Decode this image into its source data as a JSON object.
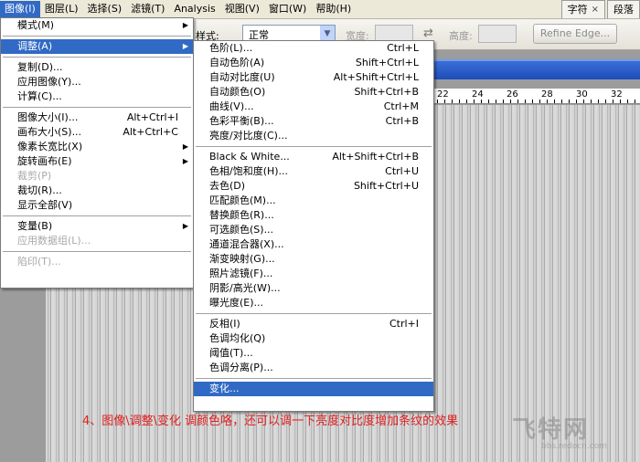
{
  "menubar": {
    "items": [
      {
        "label": "图像(I)",
        "active": true
      },
      {
        "label": "图层(L)"
      },
      {
        "label": "选择(S)"
      },
      {
        "label": "滤镜(T)"
      },
      {
        "label": "Analysis"
      },
      {
        "label": "视图(V)"
      },
      {
        "label": "窗口(W)"
      },
      {
        "label": "帮助(H)"
      }
    ],
    "panel_tabs": [
      {
        "label": "字符",
        "close": "×"
      },
      {
        "label": "段落"
      }
    ]
  },
  "options": {
    "style_label": "样式:",
    "style_value": "正常",
    "width_label": "宽度:",
    "height_label": "高度:",
    "refine_edge": "Refine Edge..."
  },
  "ruler": {
    "marks": [
      "22",
      "24",
      "26",
      "28",
      "30",
      "32"
    ]
  },
  "image_menu": {
    "items": [
      {
        "label": "模式(M)",
        "submenu": true
      },
      {
        "sep": true
      },
      {
        "label": "调整(A)",
        "submenu": true,
        "highlight": true
      },
      {
        "sep": true
      },
      {
        "label": "复制(D)..."
      },
      {
        "label": "应用图像(Y)..."
      },
      {
        "label": "计算(C)..."
      },
      {
        "sep": true
      },
      {
        "label": "图像大小(I)...",
        "shortcut": "Alt+Ctrl+I"
      },
      {
        "label": "画布大小(S)...",
        "shortcut": "Alt+Ctrl+C"
      },
      {
        "label": "像素长宽比(X)",
        "submenu": true
      },
      {
        "label": "旋转画布(E)",
        "submenu": true
      },
      {
        "label": "裁剪(P)",
        "disabled": true
      },
      {
        "label": "裁切(R)..."
      },
      {
        "label": "显示全部(V)"
      },
      {
        "sep": true
      },
      {
        "label": "变量(B)",
        "submenu": true
      },
      {
        "label": "应用数据组(L)...",
        "disabled": true
      },
      {
        "sep": true
      },
      {
        "label": "陷印(T)...",
        "disabled": true
      }
    ]
  },
  "adjust_menu": {
    "items": [
      {
        "label": "色阶(L)...",
        "shortcut": "Ctrl+L"
      },
      {
        "label": "自动色阶(A)",
        "shortcut": "Shift+Ctrl+L"
      },
      {
        "label": "自动对比度(U)",
        "shortcut": "Alt+Shift+Ctrl+L"
      },
      {
        "label": "自动颜色(O)",
        "shortcut": "Shift+Ctrl+B"
      },
      {
        "label": "曲线(V)...",
        "shortcut": "Ctrl+M"
      },
      {
        "label": "色彩平衡(B)...",
        "shortcut": "Ctrl+B"
      },
      {
        "label": "亮度/对比度(C)..."
      },
      {
        "sep": true
      },
      {
        "label": "Black & White...",
        "shortcut": "Alt+Shift+Ctrl+B"
      },
      {
        "label": "色相/饱和度(H)...",
        "shortcut": "Ctrl+U"
      },
      {
        "label": "去色(D)",
        "shortcut": "Shift+Ctrl+U"
      },
      {
        "label": "匹配颜色(M)..."
      },
      {
        "label": "替换颜色(R)..."
      },
      {
        "label": "可选颜色(S)..."
      },
      {
        "label": "通道混合器(X)..."
      },
      {
        "label": "渐变映射(G)..."
      },
      {
        "label": "照片滤镜(F)..."
      },
      {
        "label": "阴影/高光(W)..."
      },
      {
        "label": "曝光度(E)..."
      },
      {
        "sep": true
      },
      {
        "label": "反相(I)",
        "shortcut": "Ctrl+I"
      },
      {
        "label": "色调均化(Q)"
      },
      {
        "label": "阈值(T)..."
      },
      {
        "label": "色调分离(P)..."
      },
      {
        "sep": true
      },
      {
        "label": "变化...",
        "highlight": true
      }
    ]
  },
  "caption": "4、图像\\调整\\变化 调颜色咯，还可以调一下亮度对比度增加条纹的效果",
  "watermark": {
    "text": "飞特网",
    "url": "bbs.redocn.com"
  },
  "colors": {
    "highlight": "#316ac5",
    "caption": "#e02020",
    "titlebar": "#1d4db8"
  }
}
